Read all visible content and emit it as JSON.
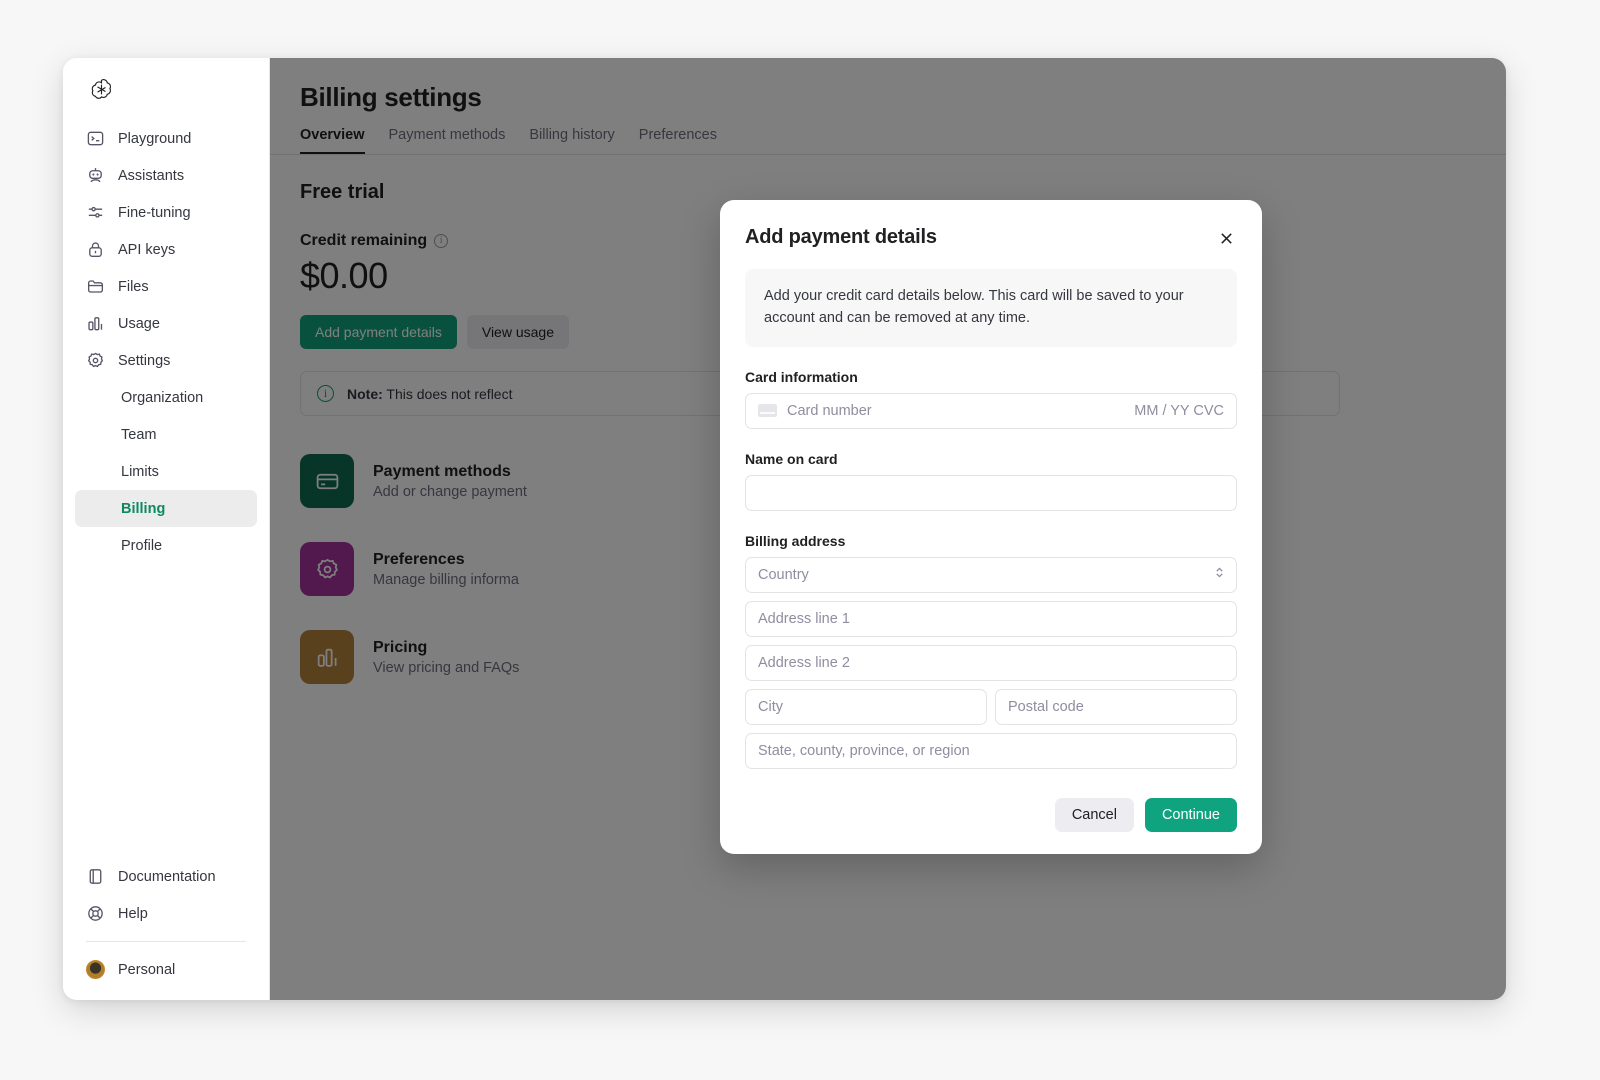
{
  "sidebar": {
    "brand_icon": "openai-logo",
    "items": [
      {
        "label": "Playground",
        "icon": "playground-icon"
      },
      {
        "label": "Assistants",
        "icon": "assistants-robot-icon"
      },
      {
        "label": "Fine-tuning",
        "icon": "fine-tuning-sliders-icon"
      },
      {
        "label": "API keys",
        "icon": "lock-icon"
      },
      {
        "label": "Files",
        "icon": "folder-icon"
      },
      {
        "label": "Usage",
        "icon": "bar-chart-icon"
      },
      {
        "label": "Settings",
        "icon": "gear-icon"
      }
    ],
    "sub_items": [
      {
        "label": "Organization",
        "active": false
      },
      {
        "label": "Team",
        "active": false
      },
      {
        "label": "Limits",
        "active": false
      },
      {
        "label": "Billing",
        "active": true
      },
      {
        "label": "Profile",
        "active": false
      }
    ],
    "footer": [
      {
        "label": "Documentation",
        "icon": "book-icon"
      },
      {
        "label": "Help",
        "icon": "lifebuoy-icon"
      }
    ],
    "account": {
      "label": "Personal",
      "icon": "avatar"
    },
    "active_color": "#0b8a62"
  },
  "page": {
    "title": "Billing settings",
    "tabs": [
      {
        "label": "Overview",
        "active": true
      },
      {
        "label": "Payment methods",
        "active": false
      },
      {
        "label": "Billing history",
        "active": false
      },
      {
        "label": "Preferences",
        "active": false
      }
    ],
    "section_title": "Free trial",
    "credit_label": "Credit remaining",
    "credit_info_icon": "info-icon",
    "credit_amount": "$0.00",
    "buttons": {
      "add_payment_details": "Add payment details",
      "view_usage": "View usage"
    },
    "note": {
      "icon": "info-icon",
      "strong": "Note:",
      "text": " This does not reflect"
    },
    "cards": [
      {
        "title": "Payment methods",
        "subtitle": "Add or change payment",
        "icon": "credit-card-icon",
        "color": "#0f6b4f"
      },
      {
        "title": "Preferences",
        "subtitle": "Manage billing informa",
        "icon": "gear-icon",
        "color": "#a3329b"
      },
      {
        "title": "Pricing",
        "subtitle": "View pricing and FAQs",
        "icon": "bar-chart-icon",
        "color": "#b2823a"
      }
    ]
  },
  "modal": {
    "title": "Add payment details",
    "close_icon": "close-icon",
    "description": "Add your credit card details below. This card will be saved to your account and can be removed at any time.",
    "card_information_label": "Card information",
    "card_number_placeholder": "Card number",
    "card_expiry_cvc_hint": "MM / YY  CVC",
    "card_brand_icon": "credit-card-icon",
    "name_on_card_label": "Name on card",
    "name_on_card_value": "",
    "billing_address_label": "Billing address",
    "country_placeholder": "Country",
    "country_chevron_icon": "chevron-up-down-icon",
    "address_line_1_placeholder": "Address line 1",
    "address_line_2_placeholder": "Address line 2",
    "city_placeholder": "City",
    "postal_code_placeholder": "Postal code",
    "state_placeholder": "State, county, province, or region",
    "cancel_label": "Cancel",
    "continue_label": "Continue",
    "accent_color": "#10a37f"
  }
}
